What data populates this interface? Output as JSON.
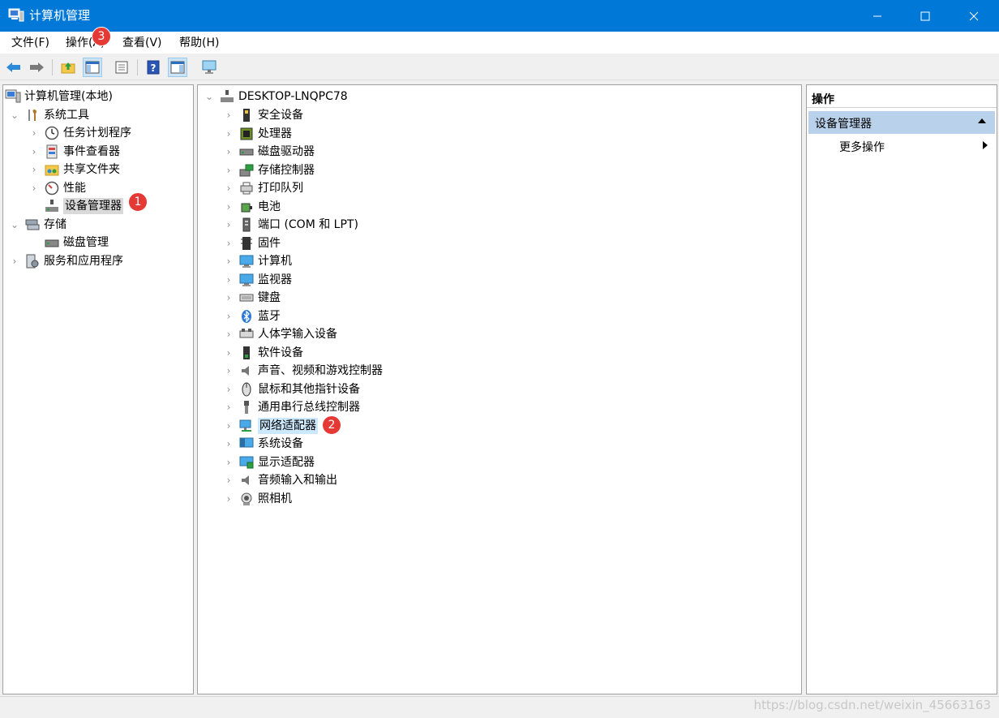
{
  "window": {
    "title": "计算机管理",
    "minimize": "minimize",
    "maximize": "maximize",
    "close": "close"
  },
  "menu": [
    {
      "label": "文件(F)"
    },
    {
      "label": "操作(A)"
    },
    {
      "label": "查看(V)"
    },
    {
      "label": "帮助(H)"
    }
  ],
  "toolbar": {
    "icons": [
      "back-arrow-icon",
      "forward-arrow-icon",
      "up-folder-icon",
      "show-hide-console-tree-icon",
      "properties-icon",
      "help-icon",
      "show-hide-action-pane-icon",
      "computer-monitor-icon"
    ]
  },
  "left_tree": {
    "root": "计算机管理(本地)",
    "system_tools": "系统工具",
    "task_scheduler": "任务计划程序",
    "event_viewer": "事件查看器",
    "shared_folders": "共享文件夹",
    "performance": "性能",
    "device_manager": "设备管理器",
    "storage": "存储",
    "disk_management": "磁盘管理",
    "services_apps": "服务和应用程序"
  },
  "device_tree": {
    "root": "DESKTOP-LNQPC78",
    "categories": [
      "安全设备",
      "处理器",
      "磁盘驱动器",
      "存储控制器",
      "打印队列",
      "电池",
      "端口 (COM 和 LPT)",
      "固件",
      "计算机",
      "监视器",
      "键盘",
      "蓝牙",
      "人体学输入设备",
      "软件设备",
      "声音、视频和游戏控制器",
      "鼠标和其他指针设备",
      "通用串行总线控制器",
      "网络适配器",
      "系统设备",
      "显示适配器",
      "音频输入和输出",
      "照相机"
    ]
  },
  "actions": {
    "header": "操作",
    "section": "设备管理器",
    "more": "更多操作"
  },
  "badges": {
    "b1": "1",
    "b2": "2",
    "b3": "3"
  },
  "watermark": "https://blog.csdn.net/weixin_45663163",
  "colors": {
    "titlebar": "#0078d7",
    "badge": "#e53935",
    "action_section": "#b9d1ea",
    "highlight": "#cce8ff"
  }
}
